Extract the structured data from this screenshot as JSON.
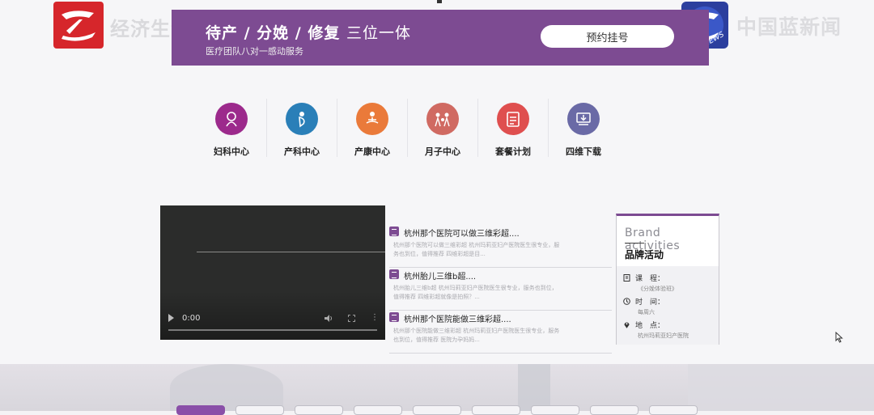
{
  "broadcast": {
    "channel_name": "经济生活",
    "news_name": "中国蓝新闻",
    "news_badge": "NEWS"
  },
  "banner": {
    "title_main": "待产 / 分娩 / 修复",
    "title_light": "三位一体",
    "subtitle": "医疗团队八对一感动服务",
    "book_button": "预约挂号",
    "color": "#7d4b92"
  },
  "nav": {
    "items": [
      {
        "label": "妇科中心",
        "color": "#9c2a8c",
        "icon": "gynecology-icon"
      },
      {
        "label": "产科中心",
        "color": "#2a7fb8",
        "icon": "obstetrics-icon"
      },
      {
        "label": "产康中心",
        "color": "#ea7a3a",
        "icon": "meditation-icon"
      },
      {
        "label": "月子中心",
        "color": "#d06a62",
        "icon": "family-icon"
      },
      {
        "label": "套餐计划",
        "color": "#df4f4f",
        "icon": "clipboard-icon"
      },
      {
        "label": "四维下载",
        "color": "#6a6aa6",
        "icon": "download-icon"
      }
    ]
  },
  "video": {
    "time": "0:00",
    "more": "⋮"
  },
  "news": {
    "items": [
      {
        "title": "杭州那个医院可以做三维彩超....",
        "desc": "杭州那个医院可以做三维彩超 杭州玛莉亚妇产医院医生很专业，服务也到位，值得推荐 四维彩超是目..."
      },
      {
        "title": "杭州胎儿三维b超....",
        "desc": "杭州胎儿三维b超 杭州玛莉亚妇产医院医生很专业，服务也到位，值得推荐 四维彩超就像是拍照？..."
      },
      {
        "title": "杭州那个医院能做三维彩超....",
        "desc": "杭州那个医院能做三维彩超 杭州玛莉亚妇产医院医生很专业，服务也到位，值得推荐 医院为孕妈妈..."
      }
    ]
  },
  "brand": {
    "title_en": "Brand activities",
    "title_cn": "品牌活动",
    "course_label": "课　程：",
    "course_value": "《分娩体验班》",
    "time_label": "时　间：",
    "time_value": "每周六",
    "place_label": "地　点：",
    "place_value": "杭州玛莉亚妇产医院"
  },
  "colors": {
    "accent": "#7d4b92",
    "tab_active": "#8a4fa8"
  }
}
